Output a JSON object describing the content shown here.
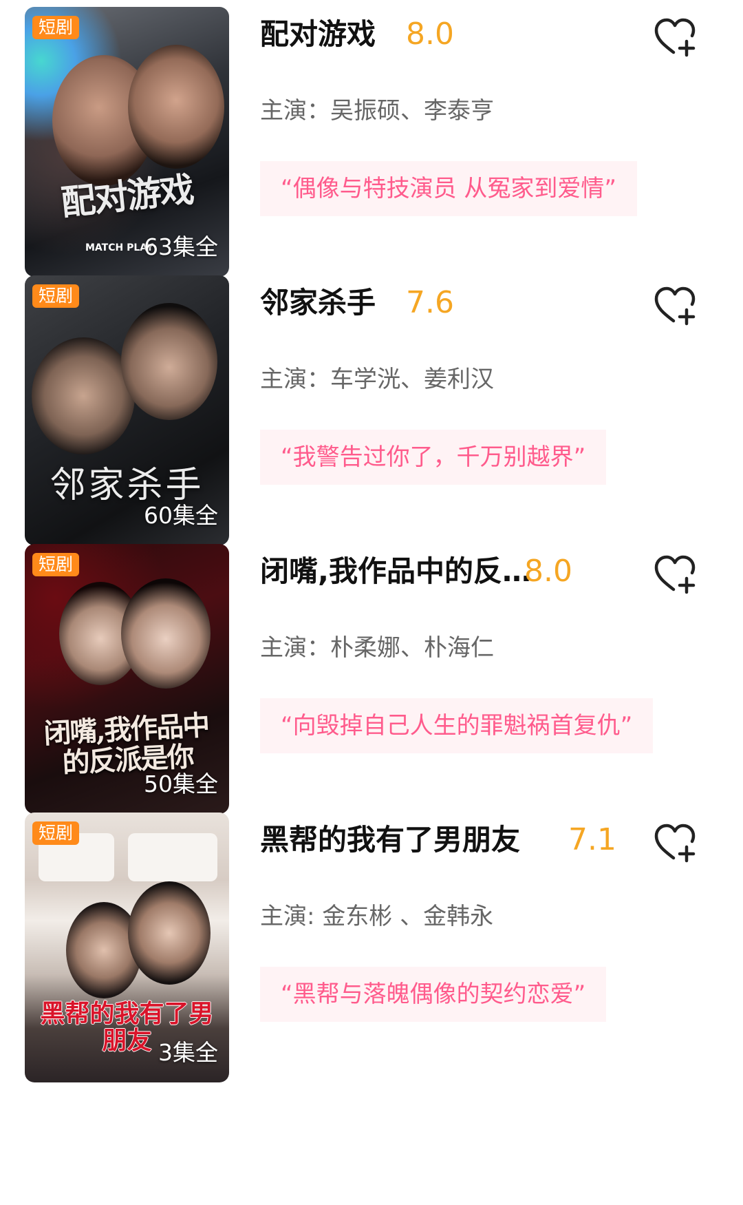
{
  "items": [
    {
      "tag": "短剧",
      "poster_title": "配对游戏",
      "poster_subtitle": "MATCH PLAY",
      "episodes": "63集全",
      "title": "配对游戏",
      "rating": "8.0",
      "cast": "主演：吴振硕、李泰亨",
      "quote": "“偶像与特技演员 从冤家到爱情”"
    },
    {
      "tag": "短剧",
      "poster_title": "邻家杀手",
      "episodes": "60集全",
      "title": "邻家杀手",
      "rating": "7.6",
      "cast": "主演：车学洸、姜利汉",
      "quote": "“我警告过你了，千万别越界”"
    },
    {
      "tag": "短剧",
      "poster_title": "闭嘴,我作品中的反派是你",
      "episodes": "50集全",
      "title": "闭嘴,我作品中的反…",
      "rating": "8.0",
      "cast": "主演：朴柔娜、朴海仁",
      "quote": "“向毁掉自己人生的罪魁祸首复仇”"
    },
    {
      "tag": "短剧",
      "poster_title": "黑帮的我有了男朋友",
      "episodes": "3集全",
      "title": "黑帮的我有了男朋友",
      "rating": "7.1",
      "cast": "主演: 金东彬 、金韩永",
      "quote": "“黑帮与落魄偶像的契约恋爱”"
    }
  ],
  "colors": {
    "tag_bg": "#ff8a1a",
    "rating": "#f5a623",
    "quote_text": "#ff5b8c",
    "quote_bg": "#fff3f5",
    "cast": "#666666"
  },
  "icons": {
    "favorite": "heart-plus-icon"
  }
}
